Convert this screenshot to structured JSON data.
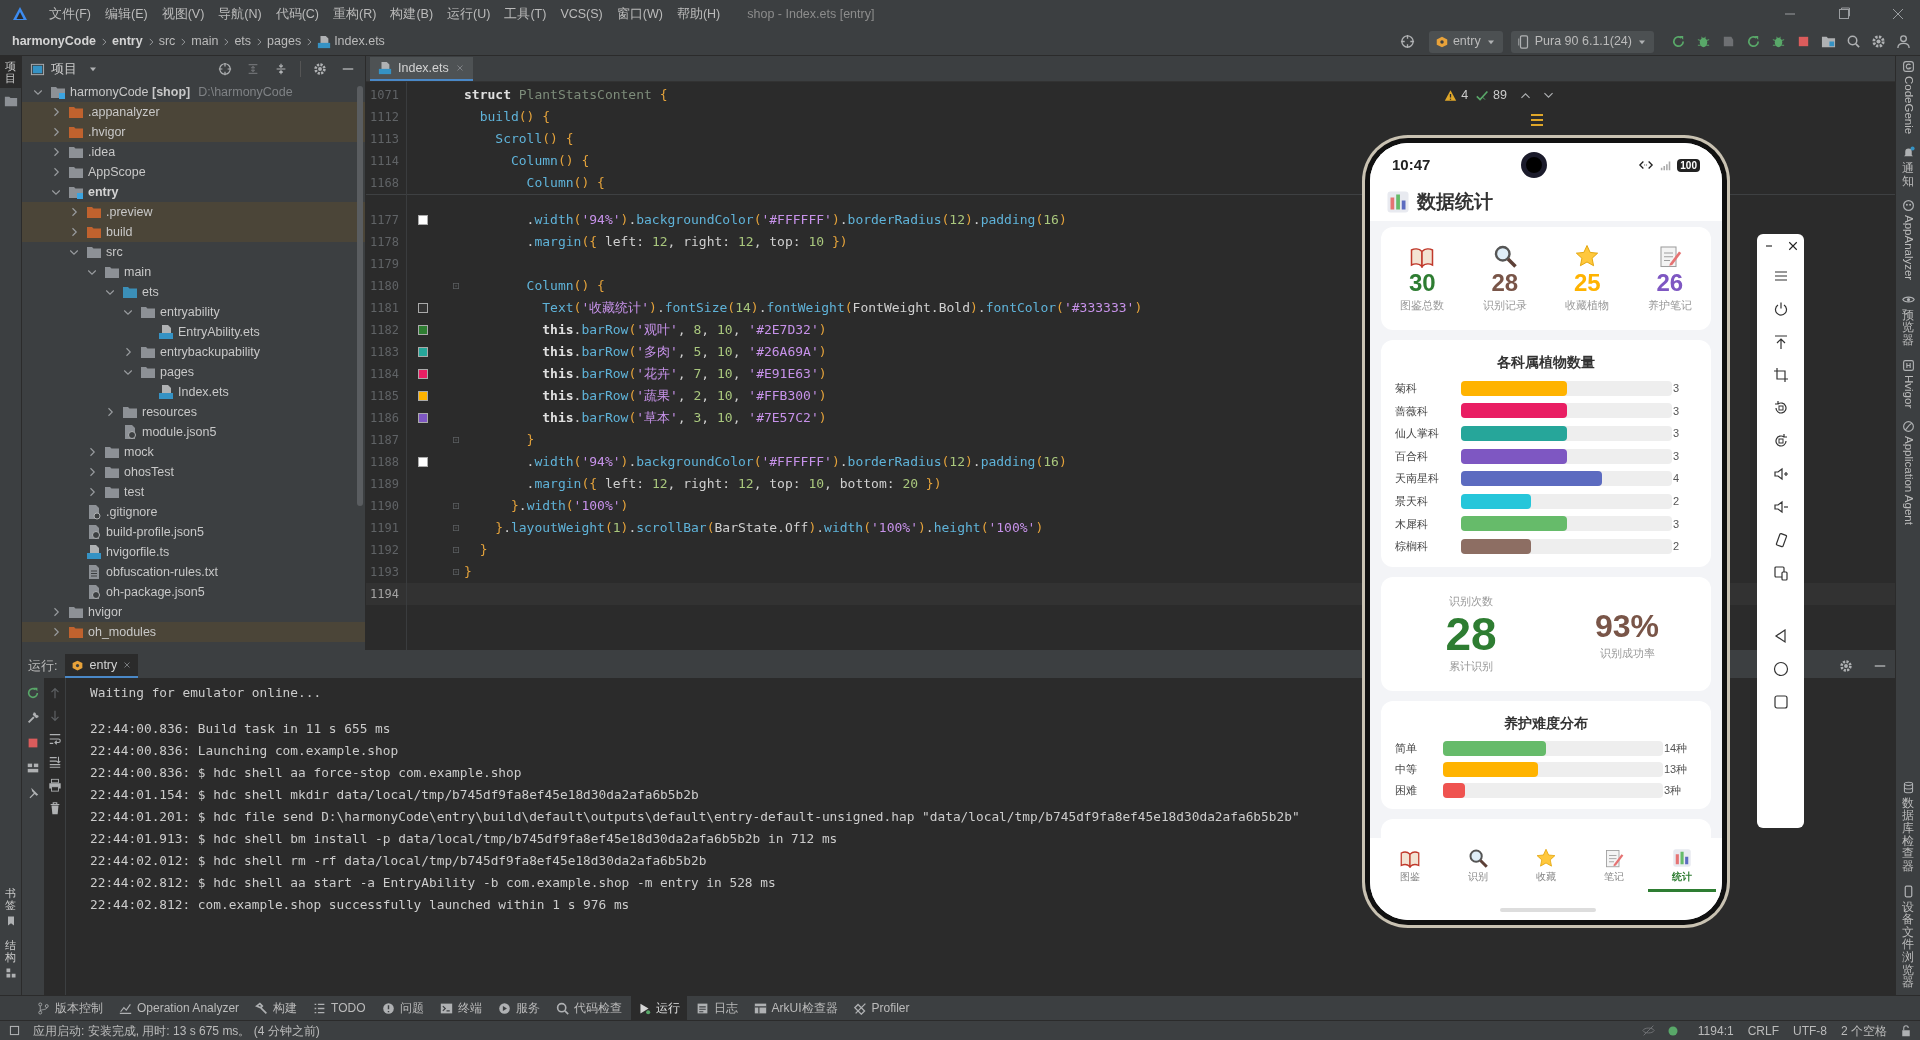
{
  "title_bar": {
    "menu": [
      "文件(F)",
      "编辑(E)",
      "视图(V)",
      "导航(N)",
      "代码(C)",
      "重构(R)",
      "构建(B)",
      "运行(U)",
      "工具(T)",
      "VCS(S)",
      "窗口(W)",
      "帮助(H)"
    ],
    "title": "shop - Index.ets [entry]"
  },
  "breadcrumb": [
    {
      "label": "harmonyCode",
      "kind": "strong"
    },
    {
      "label": "entry",
      "kind": "strong"
    },
    {
      "label": "src",
      "kind": "plain"
    },
    {
      "label": "main",
      "kind": "plain"
    },
    {
      "label": "ets",
      "kind": "plain"
    },
    {
      "label": "pages",
      "kind": "plain"
    },
    {
      "label": "Index.ets",
      "kind": "file"
    }
  ],
  "toolbar": {
    "module": "entry",
    "device": "Pura 90 6.1.1(24)"
  },
  "left_strip": {
    "top": [
      {
        "label": "项目",
        "selected": true
      }
    ],
    "bottom": [
      {
        "label": "书签",
        "selected": false
      },
      {
        "label": "结构",
        "selected": false
      }
    ]
  },
  "project_panel": {
    "title": "项目",
    "tree": [
      {
        "label": "harmonyCode **[shop]**",
        "path": "D:\\harmonyCode",
        "kind": "project",
        "expanded": true,
        "excluded": false,
        "children": [
          {
            "label": ".appanalyzer",
            "kind": "folder",
            "expanded": false,
            "excluded": true
          },
          {
            "label": ".hvigor",
            "kind": "folder",
            "expanded": false,
            "excluded": true
          },
          {
            "label": ".idea",
            "kind": "folder",
            "expanded": false,
            "excluded": false
          },
          {
            "label": "AppScope",
            "kind": "folder",
            "expanded": false,
            "excluded": false
          },
          {
            "label": "entry",
            "kind": "module",
            "expanded": true,
            "excluded": false,
            "children": [
              {
                "label": ".preview",
                "kind": "folder",
                "expanded": false,
                "excluded": true
              },
              {
                "label": "build",
                "kind": "folder",
                "expanded": false,
                "excluded": true
              },
              {
                "label": "src",
                "kind": "folder",
                "expanded": true,
                "excluded": false,
                "children": [
                  {
                    "label": "main",
                    "kind": "folder",
                    "expanded": true,
                    "excluded": false,
                    "children": [
                      {
                        "label": "ets",
                        "kind": "source",
                        "expanded": true,
                        "excluded": false,
                        "children": [
                          {
                            "label": "entryability",
                            "kind": "folder",
                            "expanded": true,
                            "excluded": false,
                            "children": [
                              {
                                "label": "EntryAbility.ets",
                                "kind": "ets",
                                "excluded": false
                              }
                            ]
                          },
                          {
                            "label": "entrybackupability",
                            "kind": "folder",
                            "expanded": false,
                            "excluded": false
                          },
                          {
                            "label": "pages",
                            "kind": "folder",
                            "expanded": true,
                            "excluded": false,
                            "children": [
                              {
                                "label": "Index.ets",
                                "kind": "ets",
                                "excluded": false
                              }
                            ]
                          }
                        ]
                      },
                      {
                        "label": "resources",
                        "kind": "folder",
                        "expanded": false,
                        "excluded": false
                      },
                      {
                        "label": "module.json5",
                        "kind": "json",
                        "excluded": false
                      }
                    ]
                  },
                  {
                    "label": "mock",
                    "kind": "folder",
                    "expanded": false,
                    "excluded": false
                  },
                  {
                    "label": "ohosTest",
                    "kind": "folder",
                    "expanded": false,
                    "excluded": false
                  },
                  {
                    "label": "test",
                    "kind": "folder",
                    "expanded": false,
                    "excluded": false
                  }
                ]
              },
              {
                "label": ".gitignore",
                "kind": "git",
                "excluded": false
              },
              {
                "label": "build-profile.json5",
                "kind": "json",
                "excluded": false
              },
              {
                "label": "hvigorfile.ts",
                "kind": "ts",
                "excluded": false
              },
              {
                "label": "obfuscation-rules.txt",
                "kind": "txt",
                "excluded": false
              },
              {
                "label": "oh-package.json5",
                "kind": "json",
                "excluded": false
              }
            ]
          },
          {
            "label": "hvigor",
            "kind": "folder",
            "expanded": false,
            "excluded": false
          },
          {
            "label": "oh_modules",
            "kind": "folder",
            "expanded": false,
            "excluded": true
          }
        ]
      }
    ]
  },
  "editor": {
    "tabs": [
      {
        "label": "Index.ets",
        "selected": true
      }
    ],
    "warnings": "4",
    "checks": "89",
    "sticky_lines": [
      {
        "number": "1071",
        "tokens": [
          {
            "kind": "keyword",
            "text": "struct "
          },
          {
            "kind": "type",
            "text": "PlantStatsContent "
          },
          {
            "kind": "brace",
            "text": "{"
          }
        ]
      },
      {
        "number": "1112",
        "tokens": [
          {
            "kind": "call",
            "text": "  build"
          },
          {
            "kind": "brace",
            "text": "() {"
          }
        ]
      },
      {
        "number": "1113",
        "tokens": [
          {
            "kind": "call",
            "text": "    Scroll"
          },
          {
            "kind": "brace",
            "text": "() {"
          }
        ]
      },
      {
        "number": "1114",
        "tokens": [
          {
            "kind": "call",
            "text": "      Column"
          },
          {
            "kind": "brace",
            "text": "() {"
          }
        ]
      },
      {
        "number": "1168",
        "tokens": [
          {
            "kind": "call",
            "text": "        Column"
          },
          {
            "kind": "brace",
            "text": "() {"
          }
        ]
      }
    ],
    "lines": [
      {
        "number": "1177",
        "color": "#ffffff",
        "fold": false,
        "current": false,
        "tokens": [
          {
            "kind": "plain",
            "text": "        ."
          },
          {
            "kind": "call",
            "text": "width"
          },
          {
            "kind": "brace",
            "text": "("
          },
          {
            "kind": "string",
            "text": "'94%'"
          },
          {
            "kind": "brace",
            "text": ")"
          },
          {
            "kind": "plain",
            "text": "."
          },
          {
            "kind": "call",
            "text": "backgroundColor"
          },
          {
            "kind": "brace",
            "text": "("
          },
          {
            "kind": "string",
            "text": "'#FFFFFF'"
          },
          {
            "kind": "brace",
            "text": ")"
          },
          {
            "kind": "plain",
            "text": "."
          },
          {
            "kind": "call",
            "text": "borderRadius"
          },
          {
            "kind": "brace",
            "text": "("
          },
          {
            "kind": "number",
            "text": "12"
          },
          {
            "kind": "brace",
            "text": ")"
          },
          {
            "kind": "plain",
            "text": "."
          },
          {
            "kind": "call",
            "text": "padding"
          },
          {
            "kind": "brace",
            "text": "("
          },
          {
            "kind": "number",
            "text": "16"
          },
          {
            "kind": "brace",
            "text": ")"
          }
        ]
      },
      {
        "number": "1178",
        "fold": false,
        "current": false,
        "tokens": [
          {
            "kind": "plain",
            "text": "        ."
          },
          {
            "kind": "call",
            "text": "margin"
          },
          {
            "kind": "brace",
            "text": "({"
          },
          {
            "kind": "plain",
            "text": " left: "
          },
          {
            "kind": "number",
            "text": "12"
          },
          {
            "kind": "plain",
            "text": ", right: "
          },
          {
            "kind": "number",
            "text": "12"
          },
          {
            "kind": "plain",
            "text": ", top: "
          },
          {
            "kind": "number",
            "text": "10"
          },
          {
            "kind": "brace",
            "text": " })"
          }
        ]
      },
      {
        "number": "1179",
        "fold": false,
        "current": false
      },
      {
        "number": "1180",
        "fold": true,
        "current": false,
        "tokens": [
          {
            "kind": "call",
            "text": "        Column"
          },
          {
            "kind": "brace",
            "text": "() {"
          }
        ]
      },
      {
        "number": "1181",
        "color": "#333333",
        "fold": false,
        "current": false,
        "tokens": [
          {
            "kind": "call",
            "text": "          Text"
          },
          {
            "kind": "brace",
            "text": "("
          },
          {
            "kind": "string",
            "text": "'收藏统计'"
          },
          {
            "kind": "brace",
            "text": ")"
          },
          {
            "kind": "plain",
            "text": "."
          },
          {
            "kind": "call",
            "text": "fontSize"
          },
          {
            "kind": "brace",
            "text": "("
          },
          {
            "kind": "number",
            "text": "14"
          },
          {
            "kind": "brace",
            "text": ")"
          },
          {
            "kind": "plain",
            "text": "."
          },
          {
            "kind": "call",
            "text": "fontWeight"
          },
          {
            "kind": "brace",
            "text": "("
          },
          {
            "kind": "plain",
            "text": "FontWeight.Bold"
          },
          {
            "kind": "brace",
            "text": ")"
          },
          {
            "kind": "plain",
            "text": "."
          },
          {
            "kind": "call",
            "text": "fontColor"
          },
          {
            "kind": "brace",
            "text": "("
          },
          {
            "kind": "string",
            "text": "'#333333'"
          },
          {
            "kind": "brace",
            "text": ")"
          }
        ]
      },
      {
        "number": "1182",
        "color": "#2e7d32",
        "fold": false,
        "current": false,
        "tokens": [
          {
            "kind": "keyword",
            "text": "          this"
          },
          {
            "kind": "plain",
            "text": "."
          },
          {
            "kind": "call",
            "text": "barRow"
          },
          {
            "kind": "brace",
            "text": "("
          },
          {
            "kind": "string",
            "text": "'观叶'"
          },
          {
            "kind": "plain",
            "text": ", "
          },
          {
            "kind": "number",
            "text": "8"
          },
          {
            "kind": "plain",
            "text": ", "
          },
          {
            "kind": "number",
            "text": "10"
          },
          {
            "kind": "plain",
            "text": ", "
          },
          {
            "kind": "string",
            "text": "'#2E7D32'"
          },
          {
            "kind": "brace",
            "text": ")"
          }
        ]
      },
      {
        "number": "1183",
        "color": "#26a69a",
        "fold": false,
        "current": false,
        "tokens": [
          {
            "kind": "keyword",
            "text": "          this"
          },
          {
            "kind": "plain",
            "text": "."
          },
          {
            "kind": "call",
            "text": "barRow"
          },
          {
            "kind": "brace",
            "text": "("
          },
          {
            "kind": "string",
            "text": "'多肉'"
          },
          {
            "kind": "plain",
            "text": ", "
          },
          {
            "kind": "number",
            "text": "5"
          },
          {
            "kind": "plain",
            "text": ", "
          },
          {
            "kind": "number",
            "text": "10"
          },
          {
            "kind": "plain",
            "text": ", "
          },
          {
            "kind": "string",
            "text": "'#26A69A'"
          },
          {
            "kind": "brace",
            "text": ")"
          }
        ]
      },
      {
        "number": "1184",
        "color": "#e91e63",
        "fold": false,
        "current": false,
        "tokens": [
          {
            "kind": "keyword",
            "text": "          this"
          },
          {
            "kind": "plain",
            "text": "."
          },
          {
            "kind": "call",
            "text": "barRow"
          },
          {
            "kind": "brace",
            "text": "("
          },
          {
            "kind": "string",
            "text": "'花卉'"
          },
          {
            "kind": "plain",
            "text": ", "
          },
          {
            "kind": "number",
            "text": "7"
          },
          {
            "kind": "plain",
            "text": ", "
          },
          {
            "kind": "number",
            "text": "10"
          },
          {
            "kind": "plain",
            "text": ", "
          },
          {
            "kind": "string",
            "text": "'#E91E63'"
          },
          {
            "kind": "brace",
            "text": ")"
          }
        ]
      },
      {
        "number": "1185",
        "color": "#ffb300",
        "fold": false,
        "current": false,
        "tokens": [
          {
            "kind": "keyword",
            "text": "          this"
          },
          {
            "kind": "plain",
            "text": "."
          },
          {
            "kind": "call",
            "text": "barRow"
          },
          {
            "kind": "brace",
            "text": "("
          },
          {
            "kind": "string",
            "text": "'蔬果'"
          },
          {
            "kind": "plain",
            "text": ", "
          },
          {
            "kind": "number",
            "text": "2"
          },
          {
            "kind": "plain",
            "text": ", "
          },
          {
            "kind": "number",
            "text": "10"
          },
          {
            "kind": "plain",
            "text": ", "
          },
          {
            "kind": "string",
            "text": "'#FFB300'"
          },
          {
            "kind": "brace",
            "text": ")"
          }
        ]
      },
      {
        "number": "1186",
        "color": "#7e57c2",
        "fold": false,
        "current": false,
        "tokens": [
          {
            "kind": "keyword",
            "text": "          this"
          },
          {
            "kind": "plain",
            "text": "."
          },
          {
            "kind": "call",
            "text": "barRow"
          },
          {
            "kind": "brace",
            "text": "("
          },
          {
            "kind": "string",
            "text": "'草本'"
          },
          {
            "kind": "plain",
            "text": ", "
          },
          {
            "kind": "number",
            "text": "3"
          },
          {
            "kind": "plain",
            "text": ", "
          },
          {
            "kind": "number",
            "text": "10"
          },
          {
            "kind": "plain",
            "text": ", "
          },
          {
            "kind": "string",
            "text": "'#7E57C2'"
          },
          {
            "kind": "brace",
            "text": ")"
          }
        ]
      },
      {
        "number": "1187",
        "fold": true,
        "current": false,
        "tokens": [
          {
            "kind": "brace",
            "text": "        }"
          }
        ]
      },
      {
        "number": "1188",
        "color": "#ffffff",
        "fold": false,
        "current": false,
        "tokens": [
          {
            "kind": "plain",
            "text": "        ."
          },
          {
            "kind": "call",
            "text": "width"
          },
          {
            "kind": "brace",
            "text": "("
          },
          {
            "kind": "string",
            "text": "'94%'"
          },
          {
            "kind": "brace",
            "text": ")"
          },
          {
            "kind": "plain",
            "text": "."
          },
          {
            "kind": "call",
            "text": "backgroundColor"
          },
          {
            "kind": "brace",
            "text": "("
          },
          {
            "kind": "string",
            "text": "'#FFFFFF'"
          },
          {
            "kind": "brace",
            "text": ")"
          },
          {
            "kind": "plain",
            "text": "."
          },
          {
            "kind": "call",
            "text": "borderRadius"
          },
          {
            "kind": "brace",
            "text": "("
          },
          {
            "kind": "number",
            "text": "12"
          },
          {
            "kind": "brace",
            "text": ")"
          },
          {
            "kind": "plain",
            "text": "."
          },
          {
            "kind": "call",
            "text": "padding"
          },
          {
            "kind": "brace",
            "text": "("
          },
          {
            "kind": "number",
            "text": "16"
          },
          {
            "kind": "brace",
            "text": ")"
          }
        ]
      },
      {
        "number": "1189",
        "fold": false,
        "current": false,
        "tokens": [
          {
            "kind": "plain",
            "text": "        ."
          },
          {
            "kind": "call",
            "text": "margin"
          },
          {
            "kind": "brace",
            "text": "({"
          },
          {
            "kind": "plain",
            "text": " left: "
          },
          {
            "kind": "number",
            "text": "12"
          },
          {
            "kind": "plain",
            "text": ", right: "
          },
          {
            "kind": "number",
            "text": "12"
          },
          {
            "kind": "plain",
            "text": ", top: "
          },
          {
            "kind": "number",
            "text": "10"
          },
          {
            "kind": "plain",
            "text": ", bottom: "
          },
          {
            "kind": "number",
            "text": "20"
          },
          {
            "kind": "brace",
            "text": " })"
          }
        ]
      },
      {
        "number": "1190",
        "fold": true,
        "current": false,
        "tokens": [
          {
            "kind": "brace",
            "text": "      }"
          },
          {
            "kind": "plain",
            "text": "."
          },
          {
            "kind": "call",
            "text": "width"
          },
          {
            "kind": "brace",
            "text": "("
          },
          {
            "kind": "string",
            "text": "'100%'"
          },
          {
            "kind": "brace",
            "text": ")"
          }
        ]
      },
      {
        "number": "1191",
        "fold": true,
        "current": false,
        "tokens": [
          {
            "kind": "brace",
            "text": "    }"
          },
          {
            "kind": "plain",
            "text": "."
          },
          {
            "kind": "call",
            "text": "layoutWeight"
          },
          {
            "kind": "brace",
            "text": "("
          },
          {
            "kind": "number",
            "text": "1"
          },
          {
            "kind": "brace",
            "text": ")"
          },
          {
            "kind": "plain",
            "text": "."
          },
          {
            "kind": "call",
            "text": "scrollBar"
          },
          {
            "kind": "brace",
            "text": "("
          },
          {
            "kind": "plain",
            "text": "BarState.Off"
          },
          {
            "kind": "brace",
            "text": ")"
          },
          {
            "kind": "plain",
            "text": "."
          },
          {
            "kind": "call",
            "text": "width"
          },
          {
            "kind": "brace",
            "text": "("
          },
          {
            "kind": "string",
            "text": "'100%'"
          },
          {
            "kind": "brace",
            "text": ")"
          },
          {
            "kind": "plain",
            "text": "."
          },
          {
            "kind": "call",
            "text": "height"
          },
          {
            "kind": "brace",
            "text": "("
          },
          {
            "kind": "string",
            "text": "'100%'"
          },
          {
            "kind": "brace",
            "text": ")"
          }
        ]
      },
      {
        "number": "1192",
        "fold": true,
        "current": false,
        "tokens": [
          {
            "kind": "brace",
            "text": "  }"
          }
        ]
      },
      {
        "number": "1193",
        "fold": true,
        "current": false,
        "tokens": [
          {
            "kind": "brace",
            "text": "}"
          }
        ]
      },
      {
        "number": "1194",
        "fold": false,
        "current": true
      }
    ]
  },
  "run_panel": {
    "label": "运行:",
    "tabs": [
      {
        "label": "entry",
        "selected": true
      }
    ],
    "output": [
      "Waiting for emulator online...",
      "22:44:00.836: Build task in 11 s 655 ms",
      "22:44:00.836: Launching com.example.shop",
      "22:44:00.836: $ hdc shell aa force-stop com.example.shop",
      "22:44:01.154: $ hdc shell mkdir data/local/tmp/b745df9fa8ef45e18d30da2afa6b5b2b",
      "22:44:01.201: $ hdc file send D:\\harmonyCode\\entry\\build\\default\\outputs\\default\\entry-default-unsigned.hap \"data/local/tmp/b745df9fa8ef45e18d30da2afa6b5b2b\"",
      "22:44:01.913: $ hdc shell bm install -p data/local/tmp/b745df9fa8ef45e18d30da2afa6b5b2b in 712 ms",
      "22:44:02.012: $ hdc shell rm -rf data/local/tmp/b745df9fa8ef45e18d30da2afa6b5b2b",
      "22:44:02.812: $ hdc shell aa start -a EntryAbility -b com.example.shop -m entry in 528 ms",
      "22:44:02.812: com.example.shop successfully launched within 1 s 976 ms"
    ]
  },
  "phone": {
    "time": "10:47",
    "battery": "100",
    "title": "数据统计",
    "stats": [
      {
        "kind": "book",
        "value": "30",
        "label": "图鉴总数",
        "color": "#2e7d32"
      },
      {
        "kind": "search",
        "value": "28",
        "label": "识别记录",
        "color": "#795548"
      },
      {
        "kind": "star",
        "value": "25",
        "label": "收藏植物",
        "color": "#ffb300"
      },
      {
        "kind": "memo",
        "value": "26",
        "label": "养护笔记",
        "color": "#7e57c2"
      }
    ],
    "family_chart": {
      "title": "各科属植物数量",
      "rows": [
        {
          "label": "菊科",
          "level": 0.5,
          "reading": "3",
          "color": "#ffb300"
        },
        {
          "label": "蔷薇科",
          "level": 0.5,
          "reading": "3",
          "color": "#e91e63"
        },
        {
          "label": "仙人掌科",
          "level": 0.5,
          "reading": "3",
          "color": "#26a69a"
        },
        {
          "label": "百合科",
          "level": 0.5,
          "reading": "3",
          "color": "#7e57c2"
        },
        {
          "label": "天南星科",
          "level": 0.667,
          "reading": "4",
          "color": "#5c6bc0"
        },
        {
          "label": "景天科",
          "level": 0.333,
          "reading": "2",
          "color": "#26c6da"
        },
        {
          "label": "木犀科",
          "level": 0.5,
          "reading": "3",
          "color": "#66bb6a"
        },
        {
          "label": "棕榈科",
          "level": 0.333,
          "reading": "2",
          "color": "#8d6e63"
        }
      ]
    },
    "recognition": {
      "count_label": "识别次数",
      "count": "28",
      "count_caption": "累计识别",
      "rate": "93%",
      "rate_caption": "识别成功率"
    },
    "difficulty": {
      "title": "养护难度分布",
      "rows": [
        {
          "label": "简单",
          "level": 0.467,
          "reading": "14种",
          "color": "#66bb6a"
        },
        {
          "label": "中等",
          "level": 0.433,
          "reading": "13种",
          "color": "#ffb300"
        },
        {
          "label": "困难",
          "level": 0.1,
          "reading": "3种",
          "color": "#ef5350"
        }
      ]
    },
    "tabs": [
      {
        "kind": "book",
        "label": "图鉴",
        "selected": false
      },
      {
        "kind": "search",
        "label": "识别",
        "selected": false
      },
      {
        "kind": "star",
        "label": "收藏",
        "selected": false
      },
      {
        "kind": "memo",
        "label": "笔记",
        "selected": false
      },
      {
        "kind": "chart",
        "label": "统计",
        "selected": true
      }
    ]
  },
  "tool_windows": [
    {
      "kind": "branch",
      "label": "版本控制",
      "selected": false
    },
    {
      "kind": "chart",
      "label": "Operation Analyzer",
      "selected": false
    },
    {
      "kind": "hammer",
      "label": "构建",
      "selected": false
    },
    {
      "kind": "list",
      "label": "TODO",
      "selected": false
    },
    {
      "kind": "alert",
      "label": "问题",
      "selected": false
    },
    {
      "kind": "terminal",
      "label": "终端",
      "selected": false
    },
    {
      "kind": "services",
      "label": "服务",
      "selected": false
    },
    {
      "kind": "inspect",
      "label": "代码检查",
      "selected": false
    },
    {
      "kind": "run",
      "label": "运行",
      "selected": true
    },
    {
      "kind": "log",
      "label": "日志",
      "selected": false
    },
    {
      "kind": "grid",
      "label": "ArkUI检查器",
      "selected": false
    },
    {
      "kind": "profiler",
      "label": "Profiler",
      "selected": false
    }
  ],
  "status_bar": {
    "message": "应用启动: 安装完成, 用时: 13 s 675 ms。 (4 分钟之前)",
    "items": [
      "1194:1",
      "CRLF",
      "UTF-8",
      "2 个空格"
    ]
  },
  "right_strip": {
    "top": [
      {
        "label": "CodeGenie",
        "kind": "latin"
      },
      {
        "label": "通知",
        "kind": "cjk"
      },
      {
        "label": "AppAnalyzer",
        "kind": "latin"
      },
      {
        "label": "预览器",
        "kind": "cjk"
      },
      {
        "label": "Hvigor",
        "kind": "latin"
      },
      {
        "label": "Application Agent",
        "kind": "latin"
      }
    ],
    "bottom": [
      {
        "label": "数据库检查器",
        "kind": "cjk"
      },
      {
        "label": "设备文件浏览器",
        "kind": "cjk"
      }
    ]
  }
}
